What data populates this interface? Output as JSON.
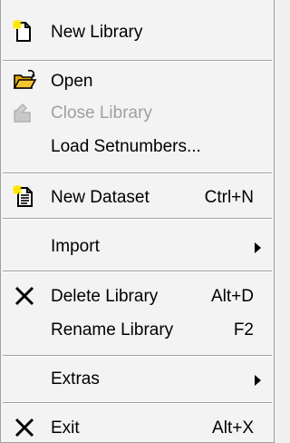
{
  "menu": {
    "items": [
      {
        "label": "New Library",
        "icon": "new-library-icon"
      },
      {
        "label": "Open",
        "icon": "open-folder-icon"
      },
      {
        "label": "Close Library",
        "icon": "close-library-icon",
        "disabled": true
      },
      {
        "label": "Load Setnumbers..."
      },
      {
        "label": "New Dataset",
        "shortcut": "Ctrl+N",
        "icon": "new-dataset-icon"
      },
      {
        "label": "Import",
        "submenu": true
      },
      {
        "label": "Delete Library",
        "shortcut": "Alt+D",
        "icon": "delete-x-icon"
      },
      {
        "label": "Rename Library",
        "shortcut": "F2"
      },
      {
        "label": "Extras",
        "submenu": true
      },
      {
        "label": "Exit",
        "shortcut": "Alt+X",
        "icon": "exit-x-icon"
      }
    ]
  },
  "colors": {
    "background": "#f3f3f3",
    "separator_dark": "#a0a0a0",
    "separator_light": "#ffffff",
    "disabled_text": "#a0a0a0",
    "folder_yellow": "#f4c430",
    "star_yellow": "#ffe600"
  }
}
